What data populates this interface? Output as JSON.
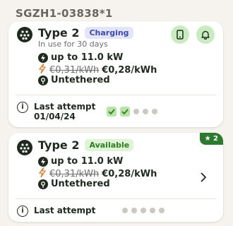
{
  "station_id": "SGZH1-03838*1",
  "connectors": [
    {
      "type": "Type 2",
      "status": "Charging",
      "in_use": "In use for 30 days",
      "power": "up to 11.0 kW",
      "old_price": "€0,31/kWh",
      "price": "€0,28/kWh",
      "cable": "Untethered",
      "last_attempt_label": "Last attempt",
      "last_attempt_date": "01/04/24",
      "attempts": [
        "success",
        "success",
        "none",
        "none",
        "none"
      ]
    },
    {
      "type": "Type 2",
      "status": "Available",
      "rating": "2",
      "power": "up to 11.0 kW",
      "old_price": "€0,31/kWh",
      "price": "€0,28/kWh",
      "cable": "Untethered",
      "last_attempt_label": "Last attempt",
      "attempts": [
        "none",
        "none",
        "none",
        "none",
        "none"
      ]
    }
  ],
  "icons": {
    "connector": "type2-connector-icon",
    "phone": "phone-icon",
    "bell": "bell-icon",
    "power": "power-icon",
    "price": "lightning-price-icon",
    "cable": "cable-icon",
    "info": "info-icon",
    "chevron": "chevron-right-icon",
    "star": "star-icon",
    "check": "check-icon"
  },
  "colors": {
    "charging_badge": "#3d49b6",
    "available_badge": "#2e7d23",
    "rating_bg": "#2b7a2f",
    "action_btn": "#c8ecc0"
  }
}
